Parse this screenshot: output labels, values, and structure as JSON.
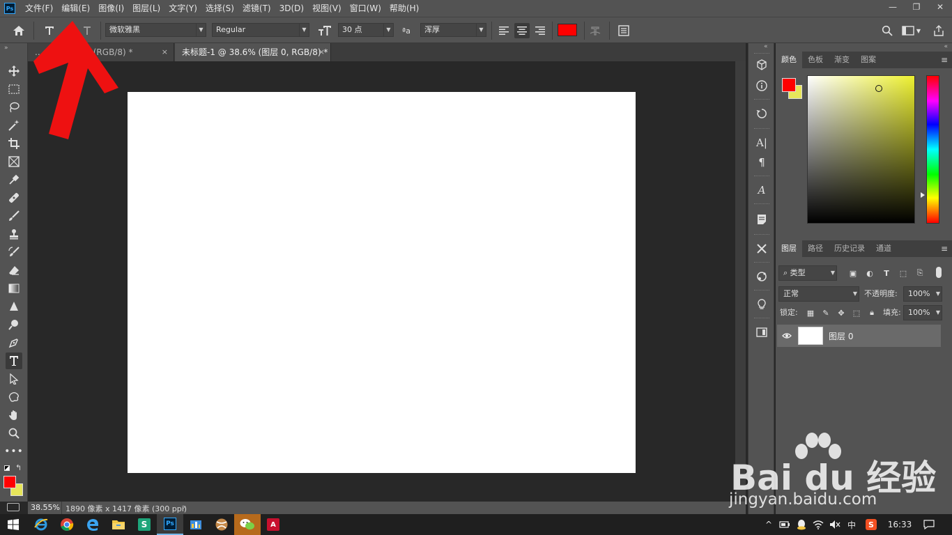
{
  "app": {
    "logo_text": "Ps",
    "menus": [
      "文件(F)",
      "编辑(E)",
      "图像(I)",
      "图层(L)",
      "文字(Y)",
      "选择(S)",
      "滤镜(T)",
      "3D(D)",
      "视图(V)",
      "窗口(W)",
      "帮助(H)"
    ],
    "window_controls": {
      "minimize": "—",
      "restore": "❐",
      "close": "✕"
    }
  },
  "options_bar": {
    "font_family": "微软雅黑",
    "font_style": "Regular",
    "font_size": "30 点",
    "antialias_label": "ªa",
    "antialias": "浑厚",
    "text_color": "#ff0000"
  },
  "tabs": [
    {
      "label": "..._0_@ 2?.7%(RGB/8) *",
      "close": "×"
    },
    {
      "label": "未标题-1 @ 38.6% (图层 0, RGB/8) *",
      "close": "×"
    }
  ],
  "status_bar": {
    "zoom": "38.55%",
    "doc_info": "1890 像素 x 1417 像素 (300 ppi)",
    "arrow": "›"
  },
  "colors": {
    "foreground": "#ff0000",
    "background": "#e7e55a",
    "accent_arrow": "#ee1111",
    "canvas": "#ffffff"
  },
  "color_panel": {
    "tabs": [
      "颜色",
      "色板",
      "渐变",
      "图案"
    ],
    "active_tab": "颜色",
    "base_hue": "#edf030"
  },
  "layers_panel": {
    "tabs": [
      "图层",
      "路径",
      "历史记录",
      "通道"
    ],
    "filter_kind": "类型",
    "blend_mode": "正常",
    "opacity_label": "不透明度:",
    "opacity": "100%",
    "lock_label": "锁定:",
    "fill_label": "填充:",
    "fill": "100%",
    "layers": [
      {
        "name": "图层 0",
        "visible": true
      }
    ]
  },
  "watermark": {
    "brand": "Bai du 经验",
    "url": "jingyan.baidu.com"
  },
  "taskbar": {
    "apps": [
      "start-icon",
      "ie-icon",
      "chrome-icon",
      "edge-icon",
      "explorer-icon",
      "wps-sheet-icon",
      "photoshop-icon",
      "bars-icon",
      "ball-icon",
      "wechat-icon",
      "acrobat-icon"
    ],
    "ps_label": "Ps",
    "wps_label": "S",
    "pdf_label": "A",
    "ime_label": "中",
    "sogou_label": "S",
    "clock": "16:33"
  }
}
